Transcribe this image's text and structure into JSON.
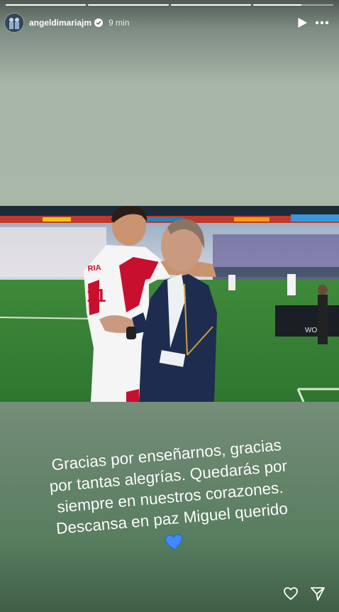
{
  "progress": [
    1,
    1,
    1,
    0.6
  ],
  "header": {
    "username": "angeldimariajm",
    "time": "9 min",
    "verified": true
  },
  "photo": {
    "jersey_text": "RIA",
    "jersey_number": "11",
    "ad_text": "WORL"
  },
  "caption": {
    "lines": [
      "Gracias por enseñarnos, gracias",
      "por tantas alegrías. Quedarás por",
      "siempre en nuestros corazones.",
      "Descansa en paz Miguel querido"
    ],
    "emoji": "blue-heart"
  },
  "icons": {
    "play": "play-icon",
    "more": "more-icon",
    "like": "heart-outline-icon",
    "share": "send-icon"
  },
  "colors": {
    "heart_blue": "#3d8bff",
    "verified_blue": "#3897f0"
  }
}
